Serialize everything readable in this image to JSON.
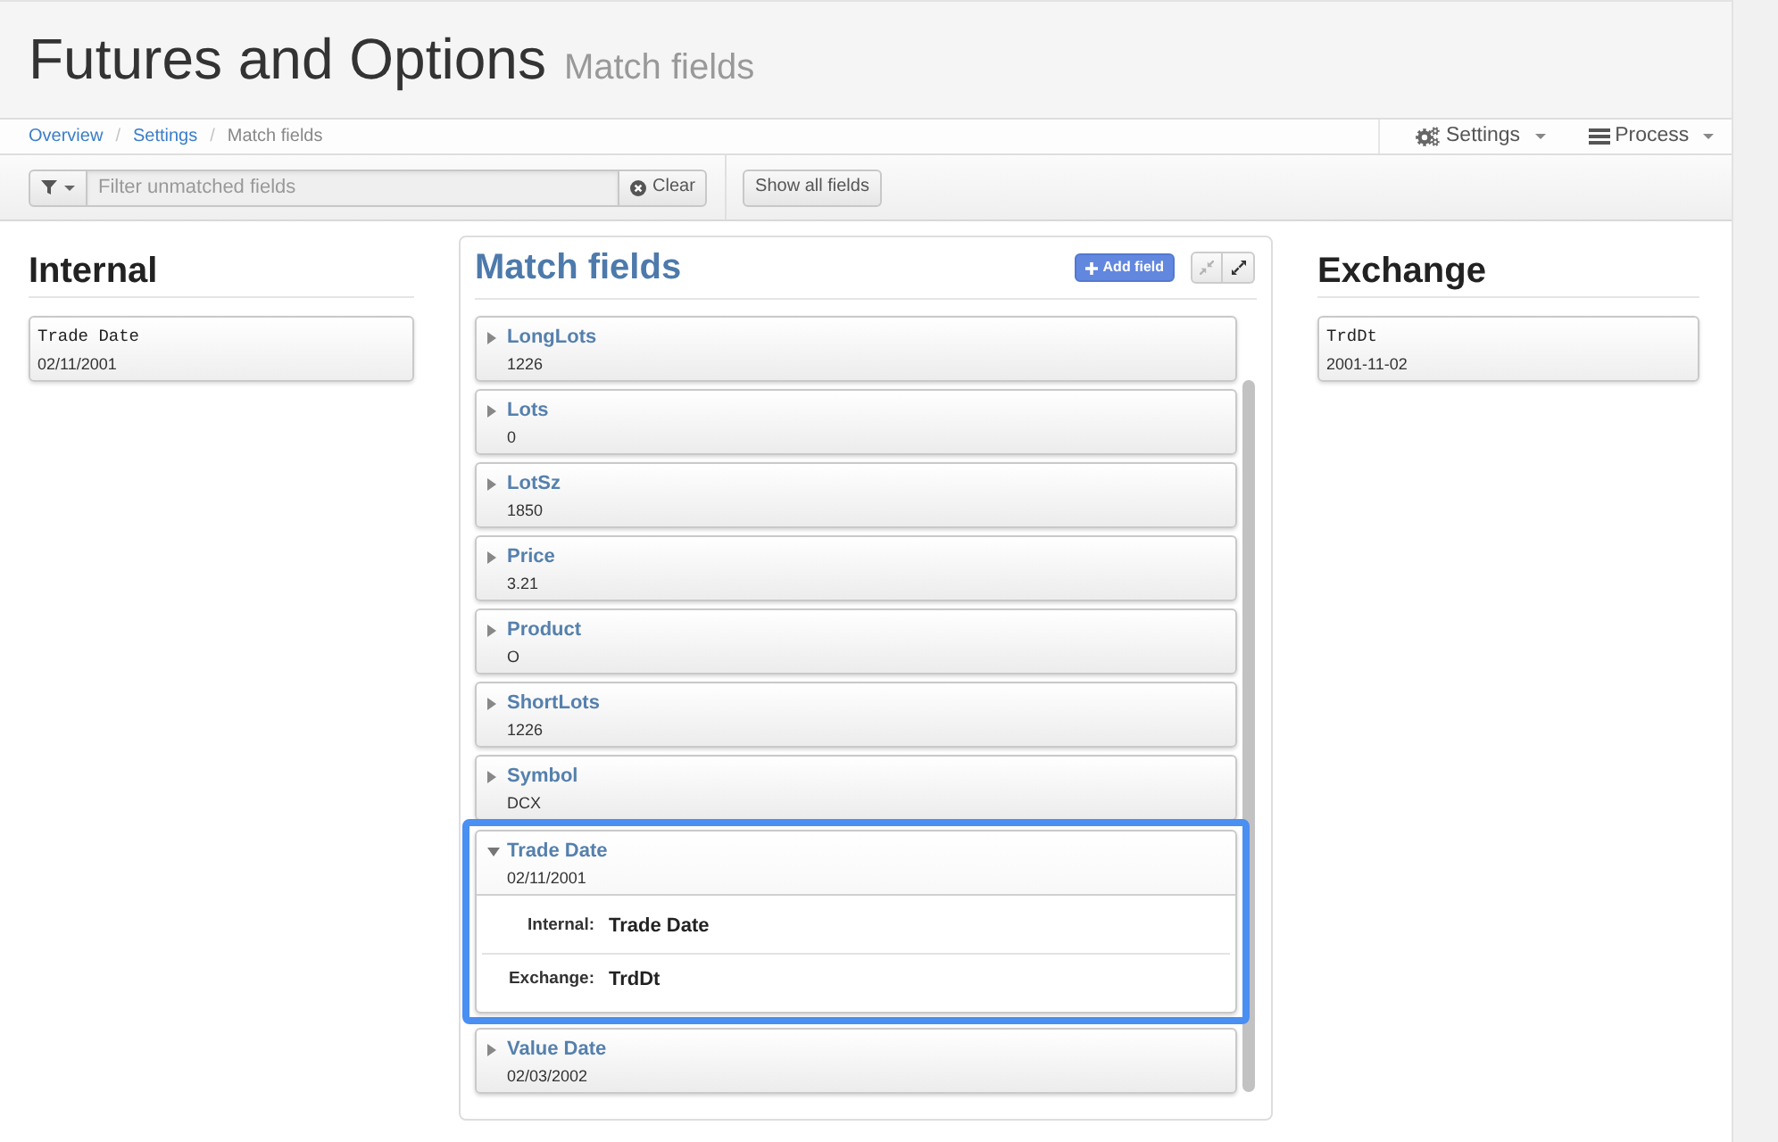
{
  "header": {
    "title": "Futures and Options",
    "subtitle": "Match fields"
  },
  "breadcrumb": [
    {
      "kind": "link",
      "label": "Overview"
    },
    {
      "kind": "divider",
      "label": "/"
    },
    {
      "kind": "link",
      "label": "Settings"
    },
    {
      "kind": "divider",
      "label": "/"
    },
    {
      "kind": "current",
      "label": "Match fields"
    }
  ],
  "menus": [
    {
      "kind": "settings",
      "label": "Settings"
    },
    {
      "kind": "process",
      "label": "Process"
    }
  ],
  "toolbar": {
    "filter": {
      "placeholder": "Filter unmatched fields"
    },
    "clear_button": "Clear",
    "show_all_button": "Show all fields"
  },
  "internal": {
    "heading": "Internal",
    "fields": [
      {
        "name": "Trade Date",
        "value": "02/11/2001"
      }
    ]
  },
  "match": {
    "heading": "Match fields",
    "add_button": "Add field",
    "view_buttons": [
      {
        "kind": "collapse",
        "disabled": true
      },
      {
        "kind": "expand",
        "disabled": false
      }
    ],
    "fields": [
      {
        "name": "LongLots",
        "value": "1226",
        "expanded": false,
        "selected": false
      },
      {
        "name": "Lots",
        "value": "0",
        "expanded": false,
        "selected": false
      },
      {
        "name": "LotSz",
        "value": "1850",
        "expanded": false,
        "selected": false
      },
      {
        "name": "Price",
        "value": "3.21",
        "expanded": false,
        "selected": false
      },
      {
        "name": "Product",
        "value": "O",
        "expanded": false,
        "selected": false
      },
      {
        "name": "ShortLots",
        "value": "1226",
        "expanded": false,
        "selected": false
      },
      {
        "name": "Symbol",
        "value": "DCX",
        "expanded": false,
        "selected": false
      },
      {
        "name": "Trade Date",
        "value": "02/11/2001",
        "expanded": true,
        "selected": true,
        "details": [
          {
            "label": "Internal:",
            "value": "Trade Date"
          },
          {
            "label": "Exchange:",
            "value": "TrdDt"
          }
        ]
      },
      {
        "name": "Value Date",
        "value": "02/03/2002",
        "expanded": false,
        "selected": false
      }
    ]
  },
  "exchange": {
    "heading": "Exchange",
    "fields": [
      {
        "name": "TrdDt",
        "value": "2001-11-02"
      }
    ]
  }
}
